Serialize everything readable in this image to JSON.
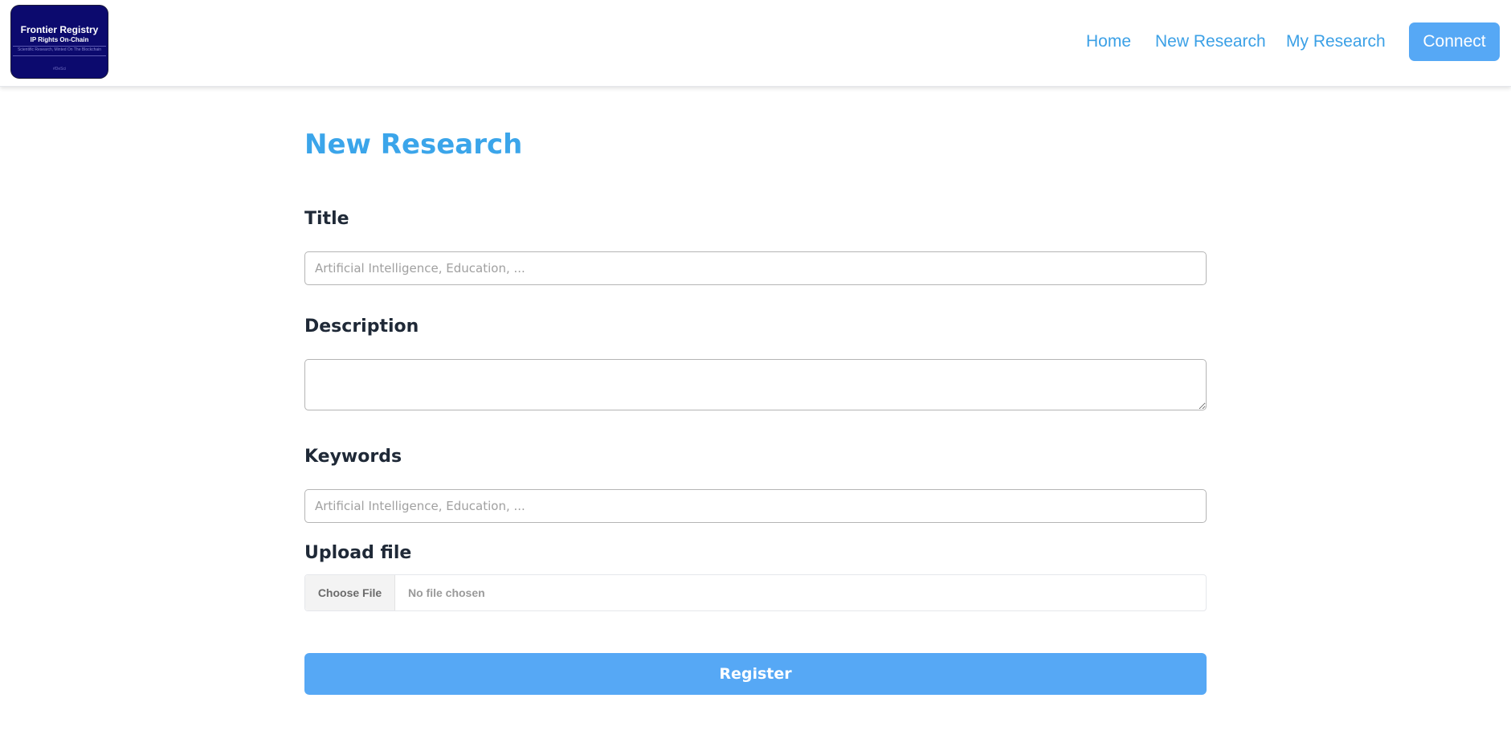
{
  "brand": {
    "logo_title": "Frontier Registry",
    "logo_subtitle": "IP Rights On-Chain",
    "logo_tagline": "Scientific Research, Minted On The Blockchain",
    "logo_footer": "#DeSci"
  },
  "nav": {
    "home": "Home",
    "new_research": "New Research",
    "my_research": "My Research",
    "connect": "Connect"
  },
  "colors": {
    "accent": "#56a8f5",
    "link": "#3ba0e6",
    "title": "#3ba5ea",
    "logo_bg": "#0c0a6e"
  },
  "form": {
    "page_title": "New Research",
    "title_label": "Title",
    "title_placeholder": "Artificial Intelligence, Education, ...",
    "title_value": "",
    "description_label": "Description",
    "description_value": "",
    "keywords_label": "Keywords",
    "keywords_placeholder": "Artificial Intelligence, Education, ...",
    "keywords_value": "",
    "upload_label": "Upload file",
    "choose_file": "Choose File",
    "file_status": "No file chosen",
    "register": "Register"
  }
}
